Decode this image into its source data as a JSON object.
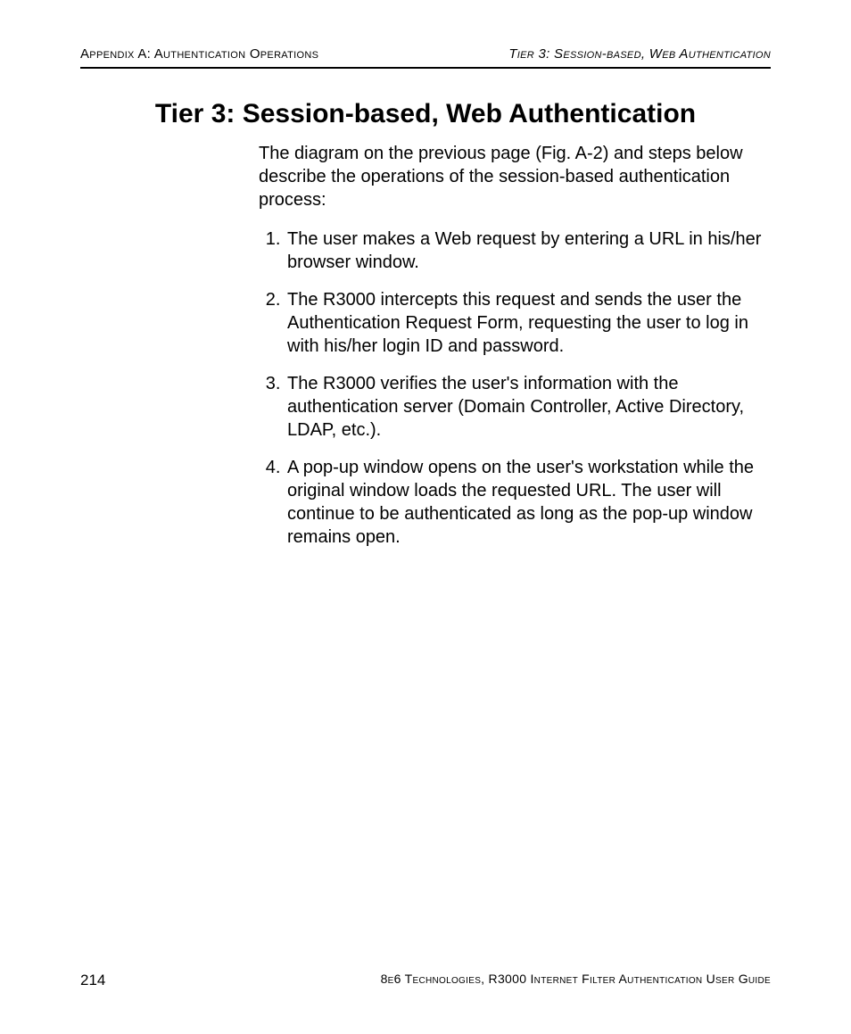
{
  "header": {
    "left": "Appendix A: Authentication Operations",
    "right": "Tier 3: Session-based, Web Authentication"
  },
  "title": "Tier 3: Session-based, Web Authentication",
  "intro": "The diagram on the previous page (Fig. A-2) and steps below describe the operations of the session-based authentication process:",
  "steps": [
    "The user makes a Web request by entering a URL in his/her browser window.",
    "The R3000 intercepts this request and sends the user the Authentication Request Form, requesting the user to log in with his/her login ID and password.",
    "The R3000 verifies the user's information with the authentication server (Domain Controller, Active Directory, LDAP, etc.).",
    "A pop-up window opens on the user's workstation while the original window loads the requested URL. The user will continue to be authenticated as long as the pop-up window remains open."
  ],
  "footer": {
    "page": "214",
    "right": "8e6 Technologies, R3000 Internet Filter Authentication User Guide"
  }
}
